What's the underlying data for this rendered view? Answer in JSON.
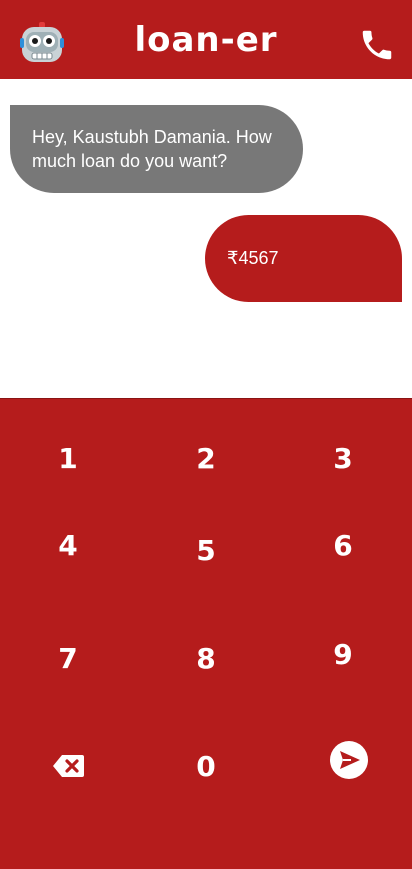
{
  "header": {
    "title": "loan-er",
    "left_icon": "robot-icon",
    "right_icon": "phone-icon",
    "background": "#b51c1c"
  },
  "chat": {
    "bot_message": "Hey, Kaustubh Damania. How much loan do you want?",
    "user_message": "₹4567",
    "bot_bubble_color": "#787878",
    "user_bubble_color": "#b51c1c"
  },
  "keypad": {
    "keys": [
      "1",
      "2",
      "3",
      "4",
      "5",
      "6",
      "7",
      "8",
      "9",
      "0"
    ],
    "backspace_icon": "backspace-icon",
    "send_icon": "send-icon"
  }
}
